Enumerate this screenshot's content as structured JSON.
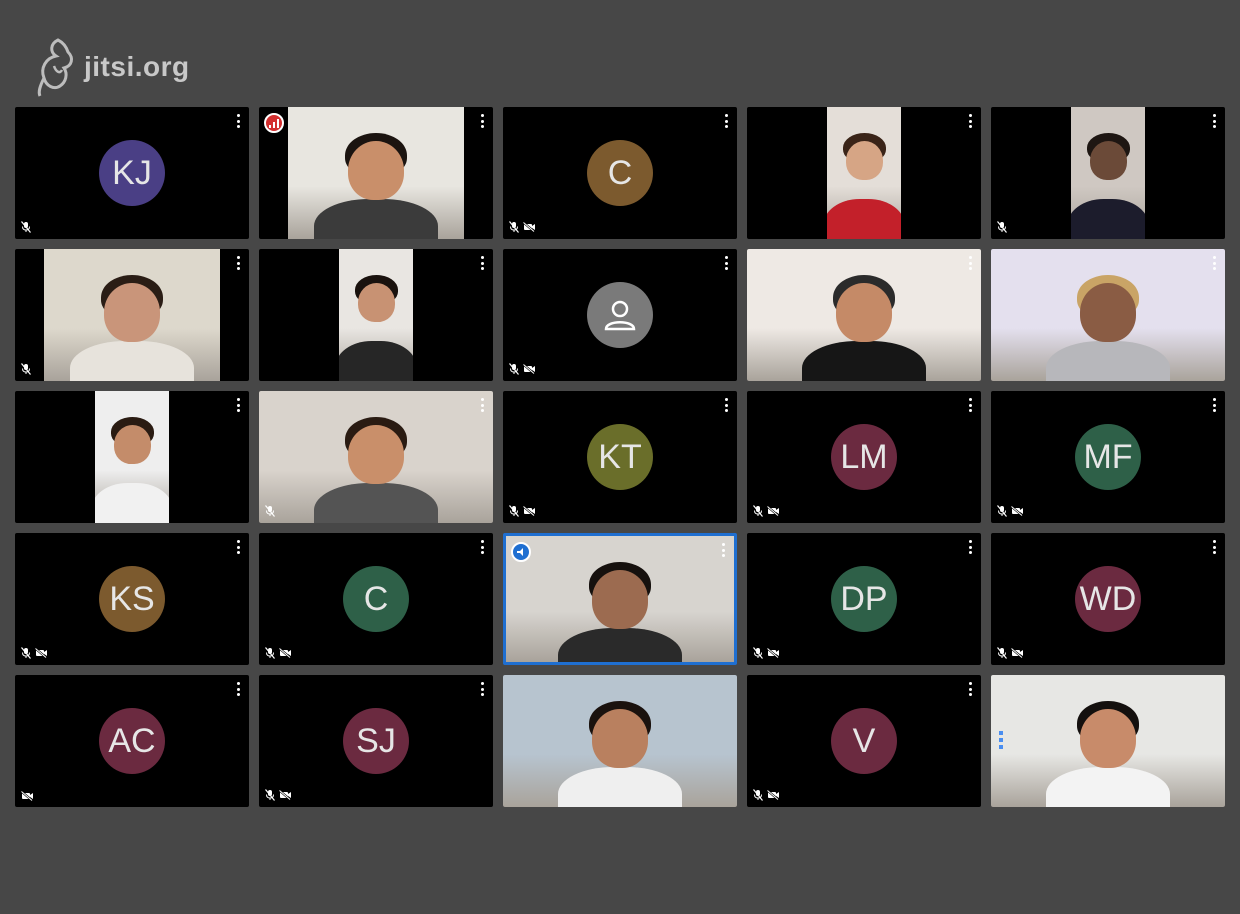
{
  "logo": {
    "text": "jitsi.org"
  },
  "colors": {
    "background": "#474747",
    "active_border": "#1f6fd1",
    "poor_connection": "#d32f2f",
    "dominant_speaker": "#1f6fd1"
  },
  "tiles": [
    {
      "id": "kj",
      "initials": "KJ",
      "avatar_color": "#4a3f85",
      "mic_muted": true,
      "video_off": false
    },
    {
      "id": "video-1",
      "video": true,
      "connection_badge": "poor",
      "mic_muted": false,
      "video_off": false
    },
    {
      "id": "c1",
      "initials": "C",
      "avatar_color": "#7c5a2e",
      "mic_muted": true,
      "video_off": true
    },
    {
      "id": "video-2",
      "video": true,
      "mic_muted": false,
      "video_off": false
    },
    {
      "id": "video-3",
      "video": true,
      "mic_muted": true,
      "video_off": false
    },
    {
      "id": "video-4",
      "video": true,
      "mic_muted": true,
      "video_off": false
    },
    {
      "id": "video-5",
      "video": true,
      "mic_muted": false,
      "video_off": false
    },
    {
      "id": "default-avatar",
      "default_avatar": true,
      "mic_muted": true,
      "video_off": true
    },
    {
      "id": "video-6",
      "video": true,
      "mic_muted": false,
      "video_off": false
    },
    {
      "id": "video-7",
      "video": true,
      "mic_muted": false,
      "video_off": false
    },
    {
      "id": "video-8",
      "video": true,
      "mic_muted": false,
      "video_off": false
    },
    {
      "id": "video-9",
      "video": true,
      "mic_muted": true,
      "video_off": false
    },
    {
      "id": "kt",
      "initials": "KT",
      "avatar_color": "#6a6e2a",
      "mic_muted": true,
      "video_off": true
    },
    {
      "id": "lm",
      "initials": "LM",
      "avatar_color": "#6b2a40",
      "mic_muted": true,
      "video_off": true
    },
    {
      "id": "mf",
      "initials": "MF",
      "avatar_color": "#2e6048",
      "mic_muted": true,
      "video_off": true
    },
    {
      "id": "ks",
      "initials": "KS",
      "avatar_color": "#7c5a2e",
      "mic_muted": true,
      "video_off": true
    },
    {
      "id": "c2",
      "initials": "C",
      "avatar_color": "#2e6048",
      "mic_muted": true,
      "video_off": true
    },
    {
      "id": "video-10",
      "video": true,
      "active": true,
      "dominant_speaker_badge": true,
      "mic_muted": false,
      "video_off": false
    },
    {
      "id": "dp",
      "initials": "DP",
      "avatar_color": "#2e6048",
      "mic_muted": true,
      "video_off": true
    },
    {
      "id": "wd",
      "initials": "WD",
      "avatar_color": "#6b2a40",
      "mic_muted": true,
      "video_off": true
    },
    {
      "id": "ac",
      "initials": "AC",
      "avatar_color": "#6b2a40",
      "mic_muted": false,
      "video_off": true
    },
    {
      "id": "sj",
      "initials": "SJ",
      "avatar_color": "#6b2a40",
      "mic_muted": true,
      "video_off": true
    },
    {
      "id": "video-11",
      "video": true,
      "mic_muted": false,
      "video_off": false,
      "no_menu": true
    },
    {
      "id": "v",
      "initials": "V",
      "avatar_color": "#6b2a40",
      "mic_muted": true,
      "video_off": true
    },
    {
      "id": "video-12-local",
      "video": true,
      "local": true,
      "mic_muted": false,
      "video_off": false,
      "no_menu": true
    }
  ]
}
